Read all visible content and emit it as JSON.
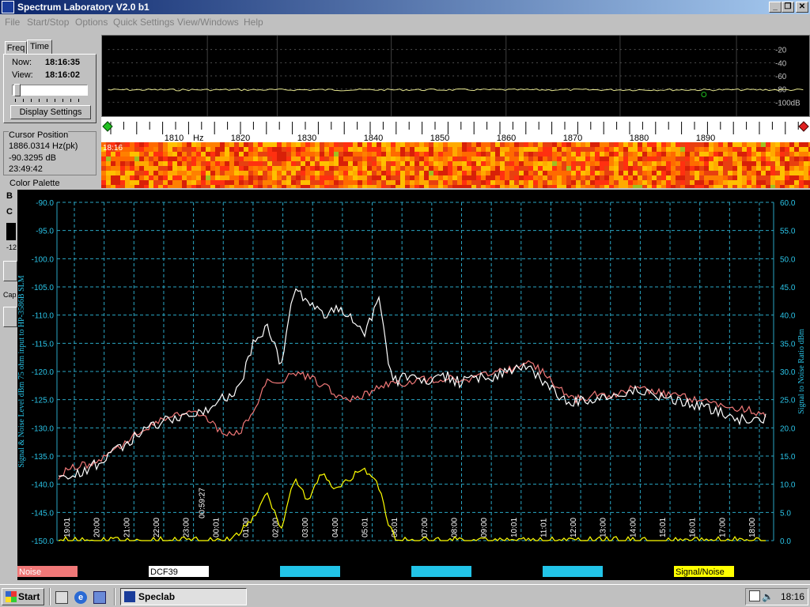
{
  "window": {
    "title": "Spectrum Laboratory V2.0 b1",
    "minimize_icon": "minimize-icon",
    "maximize_icon": "restore-icon",
    "close_icon": "close-icon"
  },
  "menu": [
    {
      "label": "File"
    },
    {
      "label": "Start/Stop"
    },
    {
      "label": "Options"
    },
    {
      "label": "Quick Settings"
    },
    {
      "label": "View/Windows"
    },
    {
      "label": "Help"
    }
  ],
  "left_panel": {
    "tabs": [
      "Freq",
      "Time"
    ],
    "now_label": "Now:",
    "now_value": "18:16:35",
    "view_label": "View:",
    "view_value": "18:16:02",
    "display_settings_label": "Display Settings",
    "cursor_group_title": "Cursor Position",
    "cursor_freq": "1886.0314 Hz(pk)",
    "cursor_level": "-90.3295 dB",
    "cursor_time": "23:49:42",
    "color_palette_title": "Color Palette",
    "palette_b": "B",
    "palette_c": "C",
    "palette_value": "-12",
    "cap_label": "Cap"
  },
  "spectrum": {
    "db_labels": [
      "-20",
      "-40",
      "-60",
      "-80",
      "-100dB"
    ],
    "freq_labels": [
      "1810",
      "1820",
      "1830",
      "1840",
      "1850",
      "1860",
      "1870",
      "1880",
      "1890"
    ],
    "hz_unit": "Hz",
    "waterfall_time": "18:16"
  },
  "chart_data": {
    "type": "line",
    "left_axis_title": "Signal & Noise Level dBm 75 ohm input to HP-3586B SLM",
    "right_axis_title": "Signal to Noise Ratio dBm",
    "left_ylim": [
      -150,
      -90
    ],
    "left_ticks": [
      "-90.0",
      "-95.0",
      "-100.0",
      "-105.0",
      "-110.0",
      "-115.0",
      "-120.0",
      "-125.0",
      "-130.0",
      "-135.0",
      "-140.0",
      "-145.0",
      "-150.0"
    ],
    "right_ylim": [
      0,
      60
    ],
    "right_ticks": [
      "60.0",
      "55.0",
      "50.0",
      "45.0",
      "40.0",
      "35.0",
      "30.0",
      "25.0",
      "20.0",
      "15.0",
      "10.0",
      "5.0",
      "0.0"
    ],
    "x_ticks": [
      "19:01",
      "20:00",
      "21:00",
      "22:00",
      "23:00",
      "00:01",
      "01:00",
      "02:00",
      "03:00",
      "04:00",
      "05:01",
      "06:01",
      "07:00",
      "08:00",
      "09:00",
      "10:01",
      "11:01",
      "12:00",
      "13:00",
      "14:00",
      "15:01",
      "16:01",
      "17:00",
      "18:00"
    ],
    "x_extra_label": "00:59:27",
    "series": [
      {
        "name": "Noise",
        "color": "#f07878",
        "values": [
          -138.5,
          -137,
          -136.5,
          -135.5,
          -134.5,
          -132,
          -130.5,
          -129,
          -128,
          -127.5,
          -127.5,
          -129,
          -131.5,
          -131,
          -127,
          -122,
          -121.5,
          -120.5,
          -121,
          -122.5,
          -124,
          -125,
          -124,
          -123,
          -122,
          -122,
          -121.5,
          -121.5,
          -121,
          -121.5,
          -121,
          -120.5,
          -120,
          -119,
          -118.5,
          -120.5,
          -123,
          -125,
          -124.5,
          -124,
          -124.5,
          -123,
          -123,
          -123.5,
          -124,
          -124.5,
          -125,
          -125.5,
          -126,
          -126.5,
          -127,
          -128
        ]
      },
      {
        "name": "DCF39",
        "color": "#ffffff",
        "values": [
          -139,
          -138.5,
          -137.5,
          -136,
          -134,
          -132.5,
          -131,
          -129.5,
          -128.5,
          -128,
          -127.5,
          -126,
          -124.5,
          -123,
          -115,
          -112,
          -119,
          -105,
          -108,
          -110,
          -108.5,
          -110,
          -114,
          -107,
          -122,
          -121,
          -122,
          -121.5,
          -121,
          -122,
          -121,
          -121,
          -120.5,
          -119.5,
          -119.5,
          -122,
          -124.5,
          -125.5,
          -125,
          -124.5,
          -124.5,
          -123.5,
          -123.5,
          -124.5,
          -125,
          -125.5,
          -126,
          -127,
          -127.5,
          -128.5,
          -129,
          -128
        ]
      },
      {
        "name": "",
        "color": "#22c4e8",
        "values": []
      },
      {
        "name": "",
        "color": "#22c4e8",
        "values": []
      },
      {
        "name": "",
        "color": "#22c4e8",
        "values": []
      },
      {
        "name": "Signal/Noise",
        "color": "#ffff00",
        "values": [
          0,
          0,
          0,
          0,
          0,
          0,
          0,
          0,
          0,
          0,
          0,
          0,
          0,
          1.5,
          4,
          8,
          2,
          11,
          7,
          12,
          9,
          11,
          13,
          10,
          1,
          0,
          0,
          0,
          0,
          0,
          0,
          0,
          0,
          0,
          0,
          0,
          0,
          0,
          0,
          0,
          0,
          0,
          0,
          0,
          0,
          0,
          0,
          0,
          0,
          0,
          0,
          0
        ]
      }
    ],
    "grid": true,
    "legend_placement": "bottom"
  },
  "taskbar": {
    "start_label": "Start",
    "task_label": "Speclab",
    "clock": "18:16",
    "quicklaunch_icons": [
      "desktop-icon",
      "ie-icon",
      "channel-icon"
    ]
  },
  "colors": {
    "grid": "#2aa6c4",
    "axis_text": "#2ac4e8",
    "waterfall_base": "#e84010"
  }
}
